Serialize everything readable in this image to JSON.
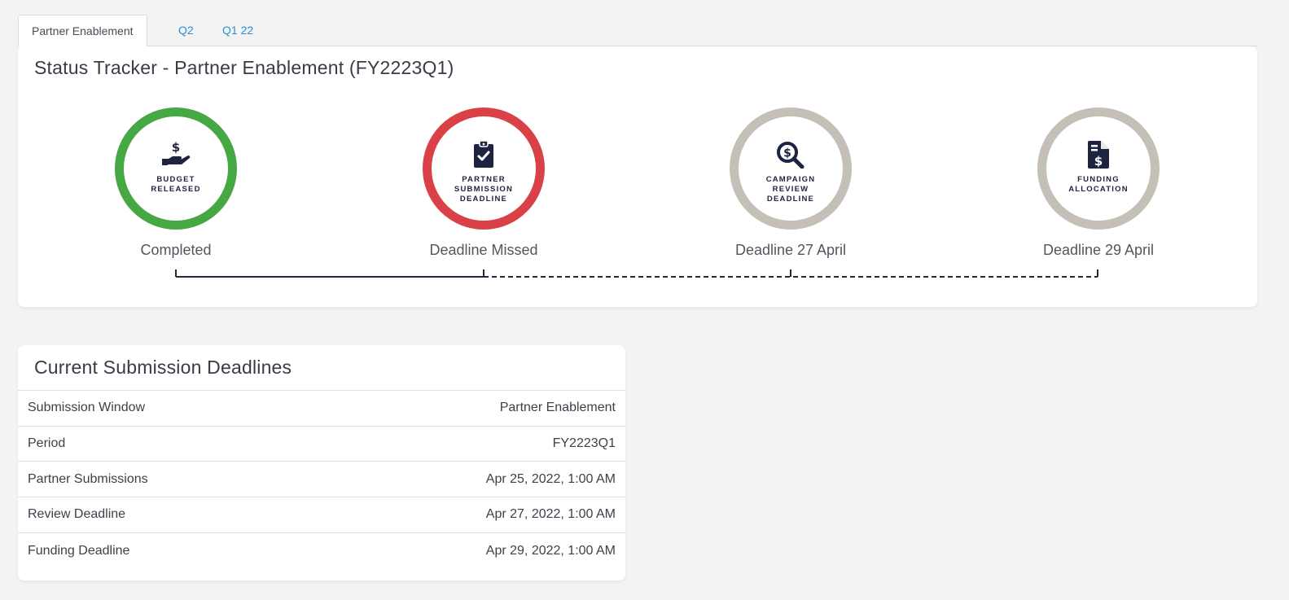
{
  "tabs": [
    {
      "label": "Partner Enablement",
      "active": true
    },
    {
      "label": "Q2",
      "active": false
    },
    {
      "label": "Q1 22",
      "active": false
    }
  ],
  "tracker": {
    "title": "Status Tracker - Partner Enablement (FY2223Q1)",
    "steps": [
      {
        "label_line1": "BUDGET",
        "label_line2": "RELEASED",
        "label_line3": "",
        "status": "Completed",
        "ring_color": "#45a843",
        "icon": "hand-dollar-icon"
      },
      {
        "label_line1": "PARTNER",
        "label_line2": "SUBMISSION",
        "label_line3": "DEADLINE",
        "status": "Deadline Missed",
        "ring_color": "#d94146",
        "icon": "clipboard-check-icon"
      },
      {
        "label_line1": "CAMPAIGN",
        "label_line2": "REVIEW",
        "label_line3": "DEADLINE",
        "status": "Deadline 27 April",
        "ring_color": "#c4bfb7",
        "icon": "search-dollar-icon"
      },
      {
        "label_line1": "FUNDING",
        "label_line2": "ALLOCATION",
        "label_line3": "",
        "status": "Deadline 29 April",
        "ring_color": "#c4bfb7",
        "icon": "invoice-dollar-icon"
      }
    ]
  },
  "deadlines": {
    "title": "Current Submission Deadlines",
    "rows": [
      {
        "label": "Submission Window",
        "value": "Partner Enablement"
      },
      {
        "label": "Period",
        "value": "FY2223Q1"
      },
      {
        "label": "Partner Submissions",
        "value": "Apr 25, 2022, 1:00 AM"
      },
      {
        "label": "Review Deadline",
        "value": "Apr 27, 2022, 1:00 AM"
      },
      {
        "label": "Funding Deadline",
        "value": "Apr 29, 2022, 1:00 AM"
      }
    ]
  },
  "colors": {
    "completed": "#45a843",
    "missed": "#d94146",
    "pending": "#c4bfb7",
    "icon": "#1e2340",
    "link": "#2b8fcf"
  }
}
